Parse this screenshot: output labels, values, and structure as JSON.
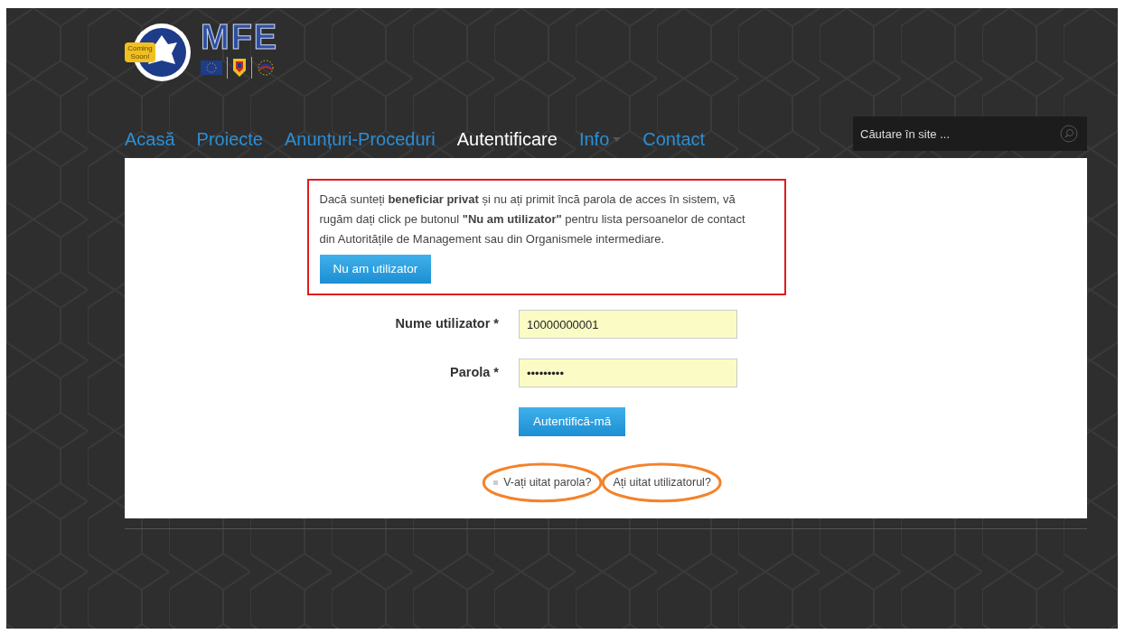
{
  "logo": {
    "wordmark": "MFE",
    "badge": "Coming Soon!"
  },
  "nav": [
    {
      "label": "Acasă",
      "selected": false,
      "dropdown": false
    },
    {
      "label": "Proiecte",
      "selected": false,
      "dropdown": false
    },
    {
      "label": "Anunțuri-Proceduri",
      "selected": false,
      "dropdown": false
    },
    {
      "label": "Autentificare",
      "selected": true,
      "dropdown": false
    },
    {
      "label": "Info",
      "selected": false,
      "dropdown": true
    },
    {
      "label": "Contact",
      "selected": false,
      "dropdown": false
    }
  ],
  "search": {
    "placeholder": "Căutare în site ..."
  },
  "notice": {
    "text": "Dacă sunteți **beneficiar privat** și nu ați primit încă parola de acces în sistem, vă rugăm dați click pe butonul **\"Nu am utilizator\"** pentru lista persoanelor de contact din Autoritățile de Management sau din Organismele intermediare.",
    "button": "Nu am utilizator"
  },
  "form": {
    "fields": [
      {
        "label": "Nume utilizator *",
        "value": "10000000001"
      },
      {
        "label": "Parola *",
        "value": "•••••••••"
      }
    ],
    "submit": "Autentifică-mă"
  },
  "links": [
    {
      "label": "V-ați uitat parola?",
      "bullet": true
    },
    {
      "label": "Ați uitat utilizatorul?",
      "bullet": false
    }
  ]
}
